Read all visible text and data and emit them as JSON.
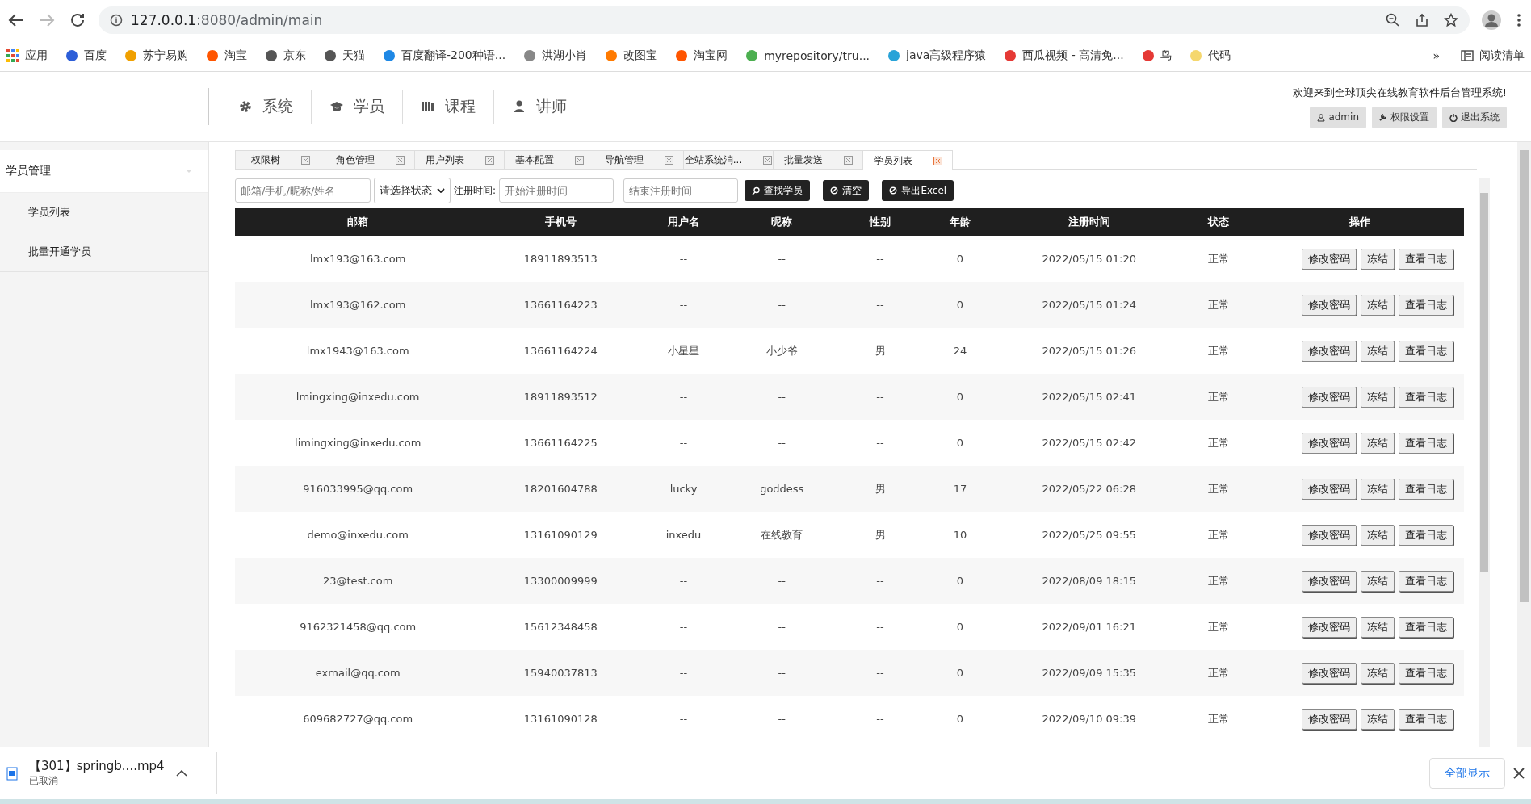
{
  "browser": {
    "url_host": "127.0.0.1",
    "url_path": ":8080/admin/main"
  },
  "bookmarks": [
    {
      "label": "应用"
    },
    {
      "label": "百度"
    },
    {
      "label": "苏宁易购"
    },
    {
      "label": "淘宝"
    },
    {
      "label": "京东"
    },
    {
      "label": "天猫"
    },
    {
      "label": "百度翻译-200种语..."
    },
    {
      "label": "洪湖小肖"
    },
    {
      "label": "改图宝"
    },
    {
      "label": "淘宝网"
    },
    {
      "label": "myrepository/tru..."
    },
    {
      "label": "java高级程序猿"
    },
    {
      "label": "西瓜视频 - 高清免..."
    },
    {
      "label": "鸟"
    },
    {
      "label": "代码"
    }
  ],
  "bookmarks_more": "»",
  "reading_list": "阅读清单",
  "header": {
    "nav": [
      {
        "label": "系统",
        "kind": "gear"
      },
      {
        "label": "学员",
        "kind": "cap"
      },
      {
        "label": "课程",
        "kind": "books"
      },
      {
        "label": "讲师",
        "kind": "person"
      }
    ],
    "welcome": "欢迎来到全球顶尖在线教育软件后台管理系统!",
    "buttons": [
      {
        "label": "admin",
        "kind": "user"
      },
      {
        "label": "权限设置",
        "kind": "wrench"
      },
      {
        "label": "退出系统",
        "kind": "power"
      }
    ]
  },
  "sidebar": {
    "group": "学员管理",
    "items": [
      {
        "label": "学员列表"
      },
      {
        "label": "批量开通学员"
      }
    ]
  },
  "tabs": [
    {
      "label": "权限树",
      "selected": false
    },
    {
      "label": "角色管理",
      "selected": false
    },
    {
      "label": "用户列表",
      "selected": false
    },
    {
      "label": "基本配置",
      "selected": false
    },
    {
      "label": "导航管理",
      "selected": false
    },
    {
      "label": "全站系统消...",
      "selected": false
    },
    {
      "label": "批量发送",
      "selected": false
    },
    {
      "label": "学员列表",
      "selected": true
    }
  ],
  "filters": {
    "search_placeholder": "邮箱/手机/昵称/姓名",
    "status_select": "请选择状态",
    "date_label": "注册时间:",
    "start_placeholder": "开始注册时间",
    "separator": "-",
    "end_placeholder": "结束注册时间",
    "buttons": [
      {
        "label": "查找学员",
        "kind": "search"
      },
      {
        "label": "清空",
        "kind": "ban"
      },
      {
        "label": "导出Excel",
        "kind": "ban"
      }
    ]
  },
  "table": {
    "columns": [
      "邮箱",
      "手机号",
      "用户名",
      "昵称",
      "性别",
      "年龄",
      "注册时间",
      "状态",
      "操作"
    ],
    "rows": [
      {
        "cells": [
          "lmx193@163.com",
          "18911893513",
          "--",
          "--",
          "--",
          "0",
          "2022/05/15 01:20",
          "正常"
        ],
        "actions": [
          "修改密码",
          "冻结",
          "查看日志"
        ]
      },
      {
        "cells": [
          "lmx193@162.com",
          "13661164223",
          "--",
          "--",
          "--",
          "0",
          "2022/05/15 01:24",
          "正常"
        ],
        "actions": [
          "修改密码",
          "冻结",
          "查看日志"
        ]
      },
      {
        "cells": [
          "lmx1943@163.com",
          "13661164224",
          "小星星",
          "小少爷",
          "男",
          "24",
          "2022/05/15 01:26",
          "正常"
        ],
        "actions": [
          "修改密码",
          "冻结",
          "查看日志"
        ]
      },
      {
        "cells": [
          "lmingxing@inxedu.com",
          "18911893512",
          "--",
          "--",
          "--",
          "0",
          "2022/05/15 02:41",
          "正常"
        ],
        "actions": [
          "修改密码",
          "冻结",
          "查看日志"
        ]
      },
      {
        "cells": [
          "limingxing@inxedu.com",
          "13661164225",
          "--",
          "--",
          "--",
          "0",
          "2022/05/15 02:42",
          "正常"
        ],
        "actions": [
          "修改密码",
          "冻结",
          "查看日志"
        ]
      },
      {
        "cells": [
          "916033995@qq.com",
          "18201604788",
          "lucky",
          "goddess",
          "男",
          "17",
          "2022/05/22 06:28",
          "正常"
        ],
        "actions": [
          "修改密码",
          "冻结",
          "查看日志"
        ]
      },
      {
        "cells": [
          "demo@inxedu.com",
          "13161090129",
          "inxedu",
          "在线教育",
          "男",
          "10",
          "2022/05/25 09:55",
          "正常"
        ],
        "actions": [
          "修改密码",
          "冻结",
          "查看日志"
        ]
      },
      {
        "cells": [
          "23@test.com",
          "13300009999",
          "--",
          "--",
          "--",
          "0",
          "2022/08/09 18:15",
          "正常"
        ],
        "actions": [
          "修改密码",
          "冻结",
          "查看日志"
        ]
      },
      {
        "cells": [
          "9162321458@qq.com",
          "15612348458",
          "--",
          "--",
          "--",
          "0",
          "2022/09/01 16:21",
          "正常"
        ],
        "actions": [
          "修改密码",
          "冻结",
          "查看日志"
        ]
      },
      {
        "cells": [
          "exmail@qq.com",
          "15940037813",
          "--",
          "--",
          "--",
          "0",
          "2022/09/09 15:35",
          "正常"
        ],
        "actions": [
          "修改密码",
          "冻结",
          "查看日志"
        ]
      },
      {
        "cells": [
          "609682727@qq.com",
          "13161090128",
          "--",
          "--",
          "--",
          "0",
          "2022/09/10 09:39",
          "正常"
        ],
        "actions": [
          "修改密码",
          "冻结",
          "查看日志"
        ]
      }
    ]
  },
  "download": {
    "file": "【301】springb....mp4",
    "status": "已取消",
    "show_all": "全部显示"
  }
}
